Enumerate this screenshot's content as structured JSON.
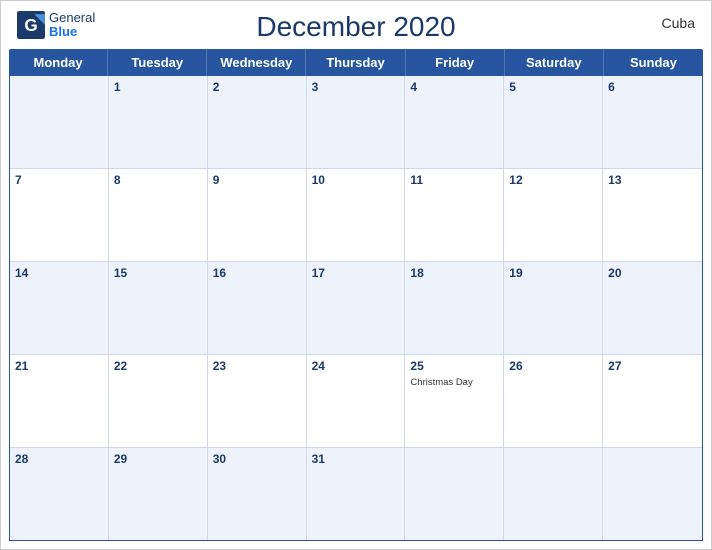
{
  "header": {
    "title": "December 2020",
    "country": "Cuba",
    "logo_general": "General",
    "logo_blue": "Blue"
  },
  "day_headers": [
    "Monday",
    "Tuesday",
    "Wednesday",
    "Thursday",
    "Friday",
    "Saturday",
    "Sunday"
  ],
  "weeks": [
    [
      {
        "num": "",
        "holiday": ""
      },
      {
        "num": "1",
        "holiday": ""
      },
      {
        "num": "2",
        "holiday": ""
      },
      {
        "num": "3",
        "holiday": ""
      },
      {
        "num": "4",
        "holiday": ""
      },
      {
        "num": "5",
        "holiday": ""
      },
      {
        "num": "6",
        "holiday": ""
      }
    ],
    [
      {
        "num": "7",
        "holiday": ""
      },
      {
        "num": "8",
        "holiday": ""
      },
      {
        "num": "9",
        "holiday": ""
      },
      {
        "num": "10",
        "holiday": ""
      },
      {
        "num": "11",
        "holiday": ""
      },
      {
        "num": "12",
        "holiday": ""
      },
      {
        "num": "13",
        "holiday": ""
      }
    ],
    [
      {
        "num": "14",
        "holiday": ""
      },
      {
        "num": "15",
        "holiday": ""
      },
      {
        "num": "16",
        "holiday": ""
      },
      {
        "num": "17",
        "holiday": ""
      },
      {
        "num": "18",
        "holiday": ""
      },
      {
        "num": "19",
        "holiday": ""
      },
      {
        "num": "20",
        "holiday": ""
      }
    ],
    [
      {
        "num": "21",
        "holiday": ""
      },
      {
        "num": "22",
        "holiday": ""
      },
      {
        "num": "23",
        "holiday": ""
      },
      {
        "num": "24",
        "holiday": ""
      },
      {
        "num": "25",
        "holiday": "Christmas Day"
      },
      {
        "num": "26",
        "holiday": ""
      },
      {
        "num": "27",
        "holiday": ""
      }
    ],
    [
      {
        "num": "28",
        "holiday": ""
      },
      {
        "num": "29",
        "holiday": ""
      },
      {
        "num": "30",
        "holiday": ""
      },
      {
        "num": "31",
        "holiday": ""
      },
      {
        "num": "",
        "holiday": ""
      },
      {
        "num": "",
        "holiday": ""
      },
      {
        "num": "",
        "holiday": ""
      }
    ]
  ]
}
